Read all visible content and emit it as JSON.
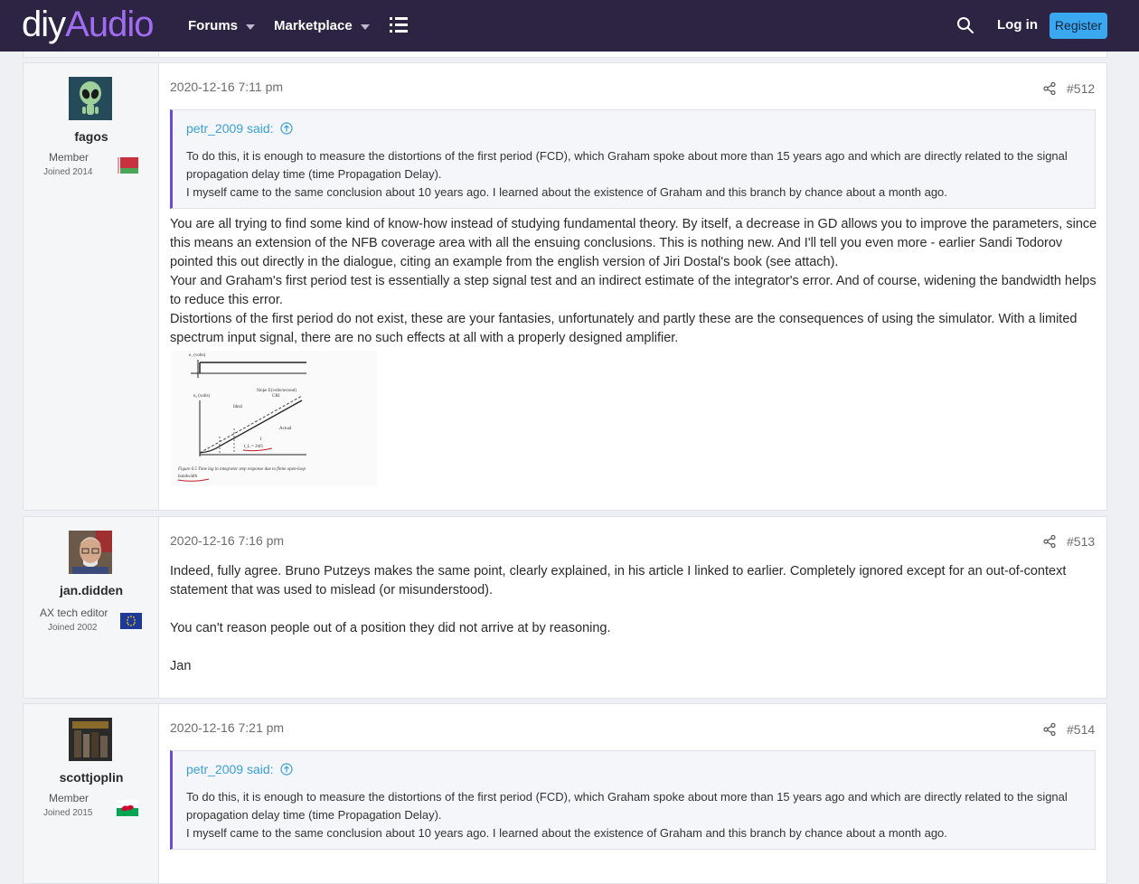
{
  "header": {
    "logo_part1": "diy",
    "logo_part2": "Audio",
    "nav_forums": "Forums",
    "nav_marketplace": "Marketplace",
    "login": "Log in",
    "register": "Register",
    "colors": {
      "bar": "#2d2342",
      "accent": "#a06cf2",
      "register": "#3aa8f0"
    }
  },
  "posts": [
    {
      "author": "fagos",
      "role": "Member",
      "joined": "Joined 2014",
      "date": "2020-12-16 7:11 pm",
      "number": "#512",
      "quote": {
        "attribution": "petr_2009 said:",
        "lines": [
          "To do this, it is enough to measure the distortions of the first period (FCD), which Graham spoke about more than 15 years ago and which are directly related to the signal propagation delay time (time Propagation Delay).",
          "I myself came to the same conclusion about 10 years ago. I learned about the existence of Graham and this branch by chance about a month ago."
        ]
      },
      "paragraphs": [
        "You are all trying to find some kind of know-how instead of studying fundamental theory. By itself, a decrease in GD allows you to improve the parameters, since this means an extension of the NFB coverage area with all the ensuing conclusions. This is nothing new. And I'll tell you even more - earlier Sandi Todorov pointed this out directly in the dialogue, citing an example from the english version of Jiri Dostal's book (see attach).",
        "Your and Graham's first period test is essentially a step signal test and an indirect estimate of the integrator's error. And of course, widening the bandwidth helps to reduce this error.",
        "Distortions of the first period do not exist, these are your fantasies, unfortunately and partly these are the consequences of using the simulator. With a limited spectrum input signal, there are no such effects at all with a properly designed amplifier."
      ],
      "figure": {
        "axis_top": "e₁ (volts)",
        "axis_bottom": "e₀ (volts)",
        "slope": "Slope E(volts/second)",
        "slope2": "CRI",
        "ideal": "Ideal",
        "actual": "Actual",
        "tl": "1",
        "tl2": "t_L = 2πf1",
        "caption1": "Figure 6.5  Time lag in integrator step response due to finite open-loop",
        "caption2": "bandwidth"
      }
    },
    {
      "author": "jan.didden",
      "role": "AX tech editor",
      "joined": "Joined 2002",
      "date": "2020-12-16 7:16 pm",
      "number": "#513",
      "paragraphs": [
        "Indeed, fully agree. Bruno Putzeys makes the same point, clearly explained, in his article I linked to earlier. Completely ignored except for an out-of-context statement that was used to mislead (or misunderstood).",
        "You can't reason people out of a position they did not arrive at by reasoning.",
        "Jan"
      ]
    },
    {
      "author": "scottjoplin",
      "role": "Member",
      "joined": "Joined 2015",
      "date": "2020-12-16 7:21 pm",
      "number": "#514",
      "quote": {
        "attribution": "petr_2009 said:",
        "lines": [
          "To do this, it is enough to measure the distortions of the first period (FCD), which Graham spoke about more than 15 years ago and which are directly related to the signal propagation delay time (time Propagation Delay).",
          "I myself came to the same conclusion about 10 years ago. I learned about the existence of Graham and this branch by chance about a month ago."
        ]
      }
    }
  ]
}
